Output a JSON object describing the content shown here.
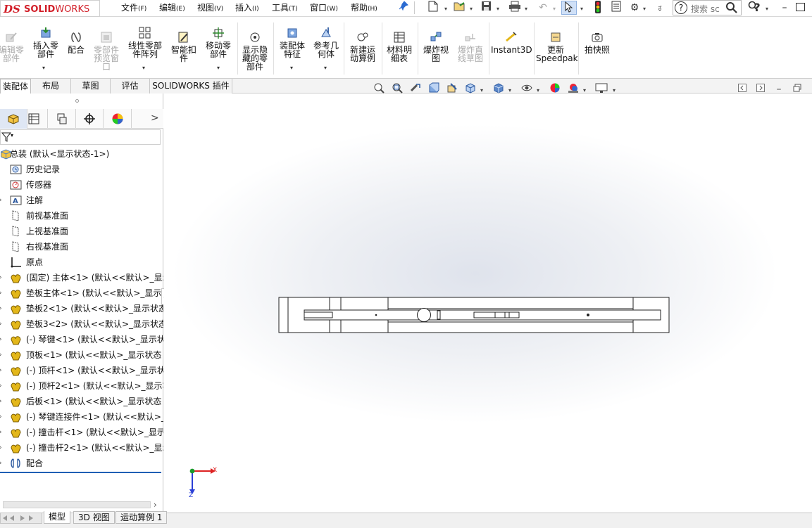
{
  "app": {
    "logo_prefix": "DS",
    "logo_brand_bold": "SOLID",
    "logo_brand_rest": "WORKS"
  },
  "menu": [
    {
      "label": "文件",
      "accel": "(F)"
    },
    {
      "label": "编辑",
      "accel": "(E)"
    },
    {
      "label": "视图",
      "accel": "(V)"
    },
    {
      "label": "插入",
      "accel": "(I)"
    },
    {
      "label": "工具",
      "accel": "(T)"
    },
    {
      "label": "窗口",
      "accel": "(W)"
    },
    {
      "label": "帮助",
      "accel": "(H)"
    }
  ],
  "search": {
    "placeholder_text": "搜索 sc",
    "help_icon_char": "?"
  },
  "quick_access": {
    "overflow_char": "⚙",
    "partial_label": "ಕ"
  },
  "ribbon": {
    "buttons": [
      {
        "label": "编辑零\n部件",
        "disabled": true,
        "icon": "edit-component-icon"
      },
      {
        "label": "插入零\n部件",
        "disabled": false,
        "icon": "insert-component-icon"
      },
      {
        "label": "配合",
        "disabled": false,
        "icon": "mate-icon"
      },
      {
        "label": "零部件\n预览窗\n口",
        "disabled": true,
        "icon": "component-preview-icon"
      },
      {
        "label": "线性零部\n件阵列",
        "disabled": false,
        "icon": "linear-pattern-icon"
      },
      {
        "label": "智能扣\n件",
        "disabled": false,
        "icon": "smart-fasteners-icon"
      },
      {
        "label": "移动零\n部件",
        "disabled": false,
        "icon": "move-component-icon"
      },
      {
        "label": "显示隐\n藏的零\n部件",
        "disabled": false,
        "icon": "show-hidden-icon"
      },
      {
        "label": "装配体\n特征",
        "disabled": false,
        "icon": "assembly-features-icon"
      },
      {
        "label": "参考几\n何体",
        "disabled": false,
        "icon": "reference-geometry-icon"
      },
      {
        "label": "新建运\n动算例",
        "disabled": false,
        "icon": "new-motion-study-icon"
      },
      {
        "label": "材料明\n细表",
        "disabled": false,
        "icon": "bom-icon"
      },
      {
        "label": "爆炸视\n图",
        "disabled": false,
        "icon": "exploded-view-icon"
      },
      {
        "label": "爆炸直\n线草图",
        "disabled": true,
        "icon": "explode-line-sketch-icon"
      },
      {
        "label": "Instant3D",
        "disabled": false,
        "icon": "instant3d-icon"
      },
      {
        "label": "更新\nSpeedpak",
        "disabled": false,
        "icon": "update-speedpak-icon"
      },
      {
        "label": "拍快照",
        "disabled": false,
        "icon": "snapshot-icon"
      }
    ]
  },
  "command_tabs": [
    {
      "label": "装配体",
      "active": true
    },
    {
      "label": "布局",
      "active": false
    },
    {
      "label": "草图",
      "active": false
    },
    {
      "label": "评估",
      "active": false
    },
    {
      "label": "SOLIDWORKS 插件",
      "active": false
    }
  ],
  "feature_manager": {
    "tabs": [
      "feature-tree",
      "property-manager",
      "configuration-manager",
      "dimxpert-manager",
      "display-manager"
    ],
    "more_char": ">",
    "items": [
      {
        "label": "总装  (默认<显示状态-1>)",
        "icon": "assembly-icon",
        "root": true
      },
      {
        "label": "历史记录",
        "icon": "history-folder-icon"
      },
      {
        "label": "传感器",
        "icon": "sensor-folder-icon"
      },
      {
        "label": "注解",
        "icon": "annotations-icon"
      },
      {
        "label": "前视基准面",
        "icon": "plane-icon"
      },
      {
        "label": "上视基准面",
        "icon": "plane-icon"
      },
      {
        "label": "右视基准面",
        "icon": "plane-icon"
      },
      {
        "label": "原点",
        "icon": "origin-icon"
      },
      {
        "label": "(固定) 主体<1> (默认<<默认>_显示",
        "icon": "part-icon",
        "expand": true
      },
      {
        "label": "垫板主体<1> (默认<<默认>_显示状",
        "icon": "part-icon",
        "expand": true
      },
      {
        "label": "垫板2<1> (默认<<默认>_显示状态",
        "icon": "part-icon",
        "expand": true
      },
      {
        "label": "垫板3<2> (默认<<默认>_显示状态",
        "icon": "part-icon",
        "expand": true
      },
      {
        "label": "(-) 琴键<1> (默认<<默认>_显示状",
        "icon": "part-icon",
        "expand": true
      },
      {
        "label": "顶板<1> (默认<<默认>_显示状态 1",
        "icon": "part-icon",
        "expand": true
      },
      {
        "label": "(-) 顶杆<1> (默认<<默认>_显示状",
        "icon": "part-icon",
        "expand": true
      },
      {
        "label": "(-) 顶杆2<1> (默认<<默认>_显示状",
        "icon": "part-icon",
        "expand": true
      },
      {
        "label": "后板<1> (默认<<默认>_显示状态 1",
        "icon": "part-icon",
        "expand": true
      },
      {
        "label": "(-) 琴键连接件<1> (默认<<默认>_显",
        "icon": "part-icon",
        "expand": true
      },
      {
        "label": "(-) 撞击杆<1> (默认<<默认>_显示",
        "icon": "part-icon",
        "expand": true
      },
      {
        "label": "(-) 撞击杆2<1> (默认<<默认>_显示",
        "icon": "part-icon",
        "expand": true
      },
      {
        "label": "配合",
        "icon": "mates-icon"
      }
    ]
  },
  "triad": {
    "x_label": "X",
    "z_label": "Z"
  },
  "bottom_tabs": [
    {
      "label": "模型",
      "active": true
    },
    {
      "label": "3D 视图",
      "active": false
    },
    {
      "label": "运动算例 1",
      "active": false
    }
  ],
  "colors": {
    "brand": "#d2202a",
    "accent": "#1f5fb4",
    "part_yellow": "#e3b71a",
    "assembly_blue": "#4f7fc3"
  }
}
